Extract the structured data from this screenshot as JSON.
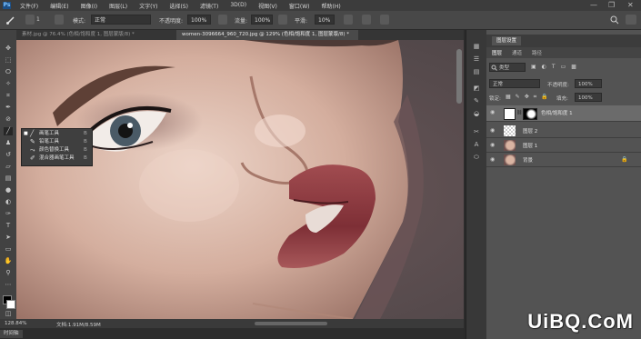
{
  "app": {
    "logo": "Ps",
    "menu": [
      "文件(F)",
      "编辑(E)",
      "图像(I)",
      "图层(L)",
      "文字(Y)",
      "选择(S)",
      "滤镜(T)",
      "3D(D)",
      "视图(V)",
      "窗口(W)",
      "帮助(H)"
    ],
    "window_controls": [
      "—",
      "❐",
      "✕"
    ]
  },
  "options_bar": {
    "brush_size": "1",
    "mode_label": "模式:",
    "mode_value": "正常",
    "opacity_label": "不透明度:",
    "opacity_value": "100%",
    "flow_label": "流量:",
    "flow_value": "100%",
    "smoothing_label": "平滑:",
    "smoothing_value": "10%"
  },
  "tabs": [
    {
      "label": "素材.jpg @ 76.4% (色相/饱和度 1, 图层蒙版/8) *",
      "active": false
    },
    {
      "label": "women-3096664_960_720.jpg @ 129% (色相/饱和度 1, 图层蒙版/8) *",
      "active": true
    }
  ],
  "status": {
    "zoom": "128.84%",
    "doc": "文档:1.91M/8.59M"
  },
  "timeline": {
    "label": "时间轴"
  },
  "tool_flyout": {
    "items": [
      {
        "label": "画笔工具",
        "shortcut": "B",
        "icon": "brush-icon",
        "glyph": "╱",
        "selected": true
      },
      {
        "label": "铅笔工具",
        "shortcut": "B",
        "icon": "pencil-icon",
        "glyph": "✎",
        "selected": false
      },
      {
        "label": "颜色替换工具",
        "shortcut": "B",
        "icon": "color-replace-icon",
        "glyph": "⤳",
        "selected": false
      },
      {
        "label": "混合器画笔工具",
        "shortcut": "B",
        "icon": "mixer-brush-icon",
        "glyph": "✐",
        "selected": false
      }
    ]
  },
  "panel": {
    "title": "图层设置",
    "tabs": [
      "图层",
      "通道",
      "路径"
    ],
    "kind_label": "类型",
    "blend_mode": "正常",
    "opacity_label": "不透明度:",
    "opacity_value": "100%",
    "lock_label": "锁定:",
    "fill_label": "填充:",
    "fill_value": "100%",
    "layers": [
      {
        "name": "色相/饱和度 1",
        "selected": true,
        "kind": "adjustment"
      },
      {
        "name": "图层 2",
        "selected": false,
        "kind": "transparent"
      },
      {
        "name": "图层 1",
        "selected": false,
        "kind": "photo"
      },
      {
        "name": "背景",
        "selected": false,
        "kind": "photo",
        "locked": true
      }
    ]
  },
  "watermark": "UiBQ.CoM",
  "colors": {
    "menubar": "#3c3c3c",
    "options": "#484848",
    "panel": "#535353",
    "selected_layer": "#6b6b6b",
    "lip": "#8d3a40",
    "skin": "#d8b8a8"
  }
}
